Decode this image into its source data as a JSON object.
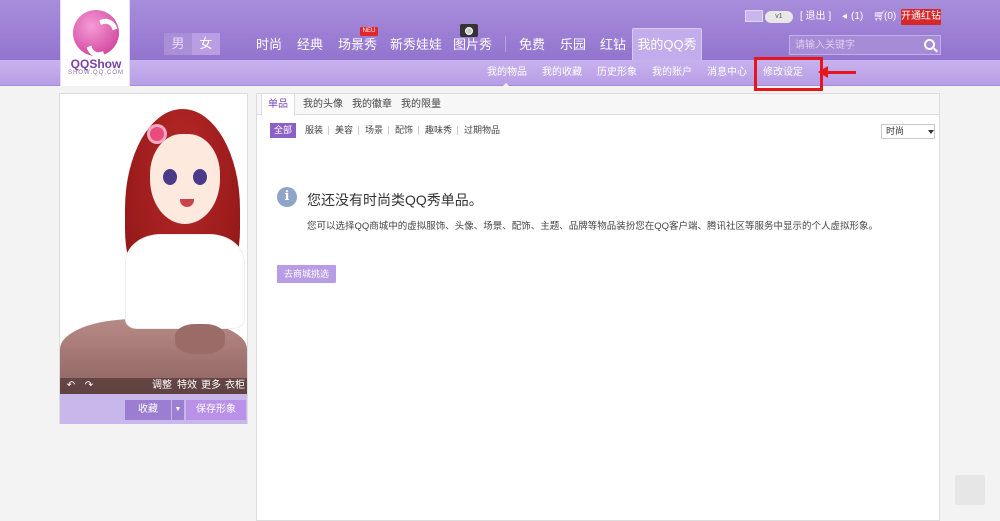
{
  "logo": {
    "text": "QQShow",
    "sub": "SHOW.QQ.COM"
  },
  "gender": {
    "male": "男",
    "female": "女"
  },
  "nav": {
    "items": [
      "时尚",
      "经典",
      "场景秀",
      "新秀娃娃",
      "图片秀",
      "免费",
      "乐园",
      "红钻"
    ],
    "active": "我的QQ秀",
    "new_badge": "NEU"
  },
  "top_util": {
    "vip_label": "v1",
    "logout": "[ 退出 ]",
    "messages": "(1)",
    "cart": "(0)",
    "open_red_diamond": "开通红钻"
  },
  "search": {
    "placeholder": "请输入关键字"
  },
  "subnav": {
    "items": [
      "我的物品",
      "我的收藏",
      "历史形象",
      "我的账户",
      "消息中心",
      "修改设定"
    ],
    "active_index": 0
  },
  "avatar_tools": {
    "adjust": "调整",
    "effects": "特效",
    "more": "更多",
    "wardrobe": "衣柜"
  },
  "avatar_actions": {
    "collect": "收藏",
    "save": "保存形象"
  },
  "tabs": [
    "单品",
    "我的头像",
    "我的徽章",
    "我的限量"
  ],
  "filters": [
    "全部",
    "服装",
    "美容",
    "场景",
    "配饰",
    "趣味秀",
    "过期物品"
  ],
  "sort_select": {
    "value": "时尚"
  },
  "empty": {
    "title": "您还没有时尚类QQ秀单品。",
    "desc": "您可以选择QQ商城中的虚拟服饰、头像、场景、配饰、主题、品牌等物品装扮您在QQ客户端、腾讯社区等服务中显示的个人虚拟形象。",
    "button": "去商城挑选"
  },
  "colors": {
    "header": "#9a7ed4",
    "accent": "#8b61c8",
    "highlight": "#e5161e"
  }
}
